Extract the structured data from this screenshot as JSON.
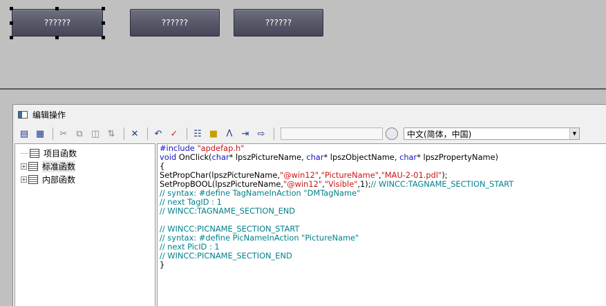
{
  "canvas": {
    "buttons": [
      {
        "label": "??????"
      },
      {
        "label": "??????"
      },
      {
        "label": "??????"
      }
    ]
  },
  "editor": {
    "title": "编辑操作",
    "language_select": "中文(简体，中国)",
    "tree": [
      {
        "label": "项目函数",
        "expandable": false
      },
      {
        "label": "标准函数",
        "expandable": true
      },
      {
        "label": "内部函数",
        "expandable": true
      }
    ],
    "code": {
      "l1a": "#include ",
      "l1b": "\"apdefap.h\"",
      "l2a": "void",
      "l2b": " OnClick(",
      "l2c": "char",
      "l2d": "* lpszPictureName, ",
      "l2e": "char",
      "l2f": "* lpszObjectName, ",
      "l2g": "char",
      "l2h": "* lpszPropertyName)",
      "l3": "{",
      "l4a": "SetPropChar(lpszPictureName,",
      "l4b": "\"@win12\"",
      "l4c": ",",
      "l4d": "\"PictureName\"",
      "l4e": ",",
      "l4f": "\"MAU-2-01.pdl\"",
      "l4g": ");",
      "l5a": "SetPropBOOL(lpszPictureName,",
      "l5b": "\"@win12\"",
      "l5c": ",",
      "l5d": "\"Visible\"",
      "l5e": ",1);",
      "l5f": "// WINCC:TAGNAME_SECTION_START",
      "l6": "// syntax: #define TagNameInAction \"DMTagName\"",
      "l7": "// next TagID : 1",
      "l8": "// WINCC:TAGNAME_SECTION_END",
      "l9": "",
      "l10": "// WINCC:PICNAME_SECTION_START",
      "l11": "// syntax: #define PicNameInAction \"PictureName\"",
      "l12": "// next PicID : 1",
      "l13": "// WINCC:PICNAME_SECTION_END",
      "l14": "}"
    }
  }
}
